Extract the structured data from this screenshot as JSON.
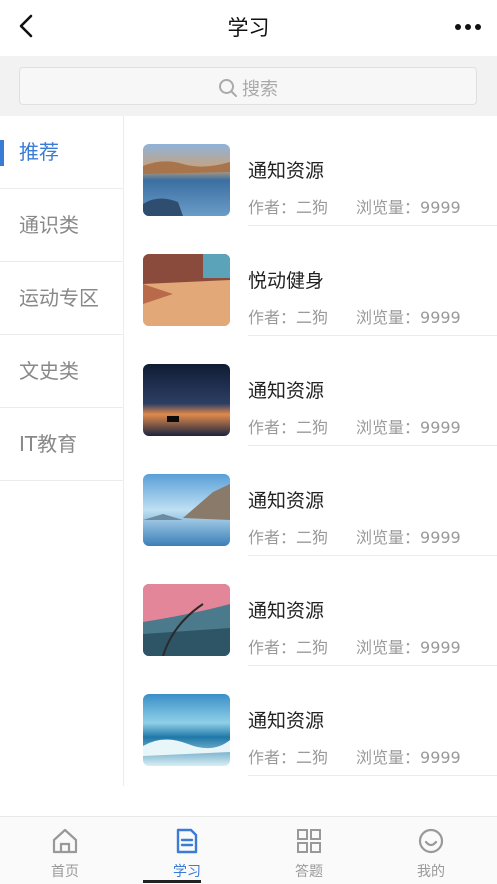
{
  "header": {
    "title": "学习",
    "back_icon": "chevron-left-icon",
    "more_icon": "more-dots-icon"
  },
  "search": {
    "placeholder": "搜索",
    "icon": "search-icon"
  },
  "sidebar": {
    "items": [
      {
        "label": "推荐",
        "active": true
      },
      {
        "label": "通识类",
        "active": false
      },
      {
        "label": "运动专区",
        "active": false
      },
      {
        "label": "文史类",
        "active": false
      },
      {
        "label": "IT教育",
        "active": false
      }
    ]
  },
  "list": {
    "items": [
      {
        "title": "通知资源",
        "author": "作者：二狗",
        "views": "浏览量：9999",
        "thumb": "lake-rocks"
      },
      {
        "title": "悦动健身",
        "author": "作者：二狗",
        "views": "浏览量：9999",
        "thumb": "street"
      },
      {
        "title": "通知资源",
        "author": "作者：二狗",
        "views": "浏览量：9999",
        "thumb": "night-piano"
      },
      {
        "title": "通知资源",
        "author": "作者：二狗",
        "views": "浏览量：9999",
        "thumb": "mountain-lake"
      },
      {
        "title": "通知资源",
        "author": "作者：二狗",
        "views": "浏览量：9999",
        "thumb": "blossom-tree"
      },
      {
        "title": "通知资源",
        "author": "作者：二狗",
        "views": "浏览量：9999",
        "thumb": "ocean-waves"
      }
    ]
  },
  "tabbar": {
    "tabs": [
      {
        "label": "首页",
        "icon": "home-icon",
        "active": false
      },
      {
        "label": "学习",
        "icon": "document-icon",
        "active": true
      },
      {
        "label": "答题",
        "icon": "grid-icon",
        "active": false
      },
      {
        "label": "我的",
        "icon": "smile-icon",
        "active": false
      }
    ]
  },
  "colors": {
    "accent": "#3a7bd5",
    "text": "#222222",
    "muted": "#9a9a9a",
    "background": "#f2f2f2"
  }
}
